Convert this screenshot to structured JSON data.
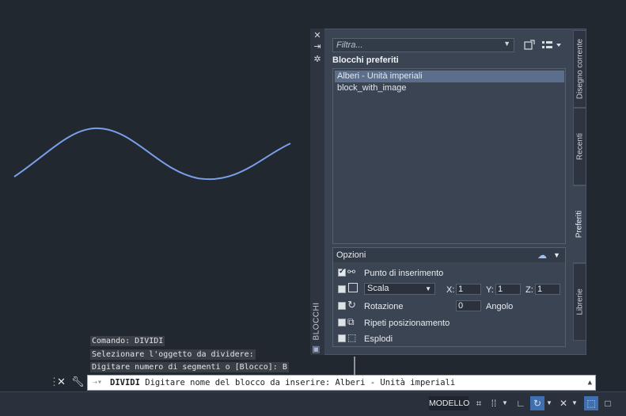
{
  "palette": {
    "vertical_title": "BLOCCHI",
    "filter_placeholder": "Filtra...",
    "library_title": "Blocchi preferiti",
    "blocks": [
      "Alberi - Unità imperiali",
      "block_with_image"
    ],
    "selected_index": 0,
    "tabs": [
      "Disegno corrente",
      "Recenti",
      "Preferiti",
      "Librerie"
    ],
    "active_tab": "Preferiti"
  },
  "options": {
    "header": "Opzioni",
    "insertion_point": {
      "label": "Punto di inserimento",
      "checked": true
    },
    "scale": {
      "mode": "Scala",
      "checked": false,
      "x_label": "X:",
      "x": "1",
      "y_label": "Y:",
      "y": "1",
      "z_label": "Z:",
      "z": "1"
    },
    "rotation": {
      "label": "Rotazione",
      "checked": false,
      "value": "0",
      "angle_label": "Angolo"
    },
    "repeat": {
      "label": "Ripeti posizionamento",
      "checked": false
    },
    "explode": {
      "label": "Esplodi",
      "checked": false
    }
  },
  "command_history": [
    "Comando: DIVIDI",
    "Selezionare l'oggetto da dividere:",
    "Digitare numero di segmenti o [Blocco]: B"
  ],
  "command_line": {
    "command": "DIVIDI",
    "prompt": "Digitare nome del blocco da inserire: Alberi - Unità imperiali"
  },
  "statusbar": {
    "model_label": "MODELLO"
  },
  "icons": [
    "close-icon",
    "pin-icon",
    "settings-icon",
    "palette-blocks-icon",
    "refresh-icon",
    "view-options-icon",
    "cloud-sync-icon",
    "wrench-icon",
    "grid-icon",
    "snap-icon",
    "ortho-icon",
    "polar-icon",
    "osnap-icon",
    "viewport-icon"
  ],
  "colors": {
    "curve": "#7a9ee8",
    "background": "#212830",
    "panel": "#3b4453",
    "selection": "#5b6f8c"
  }
}
